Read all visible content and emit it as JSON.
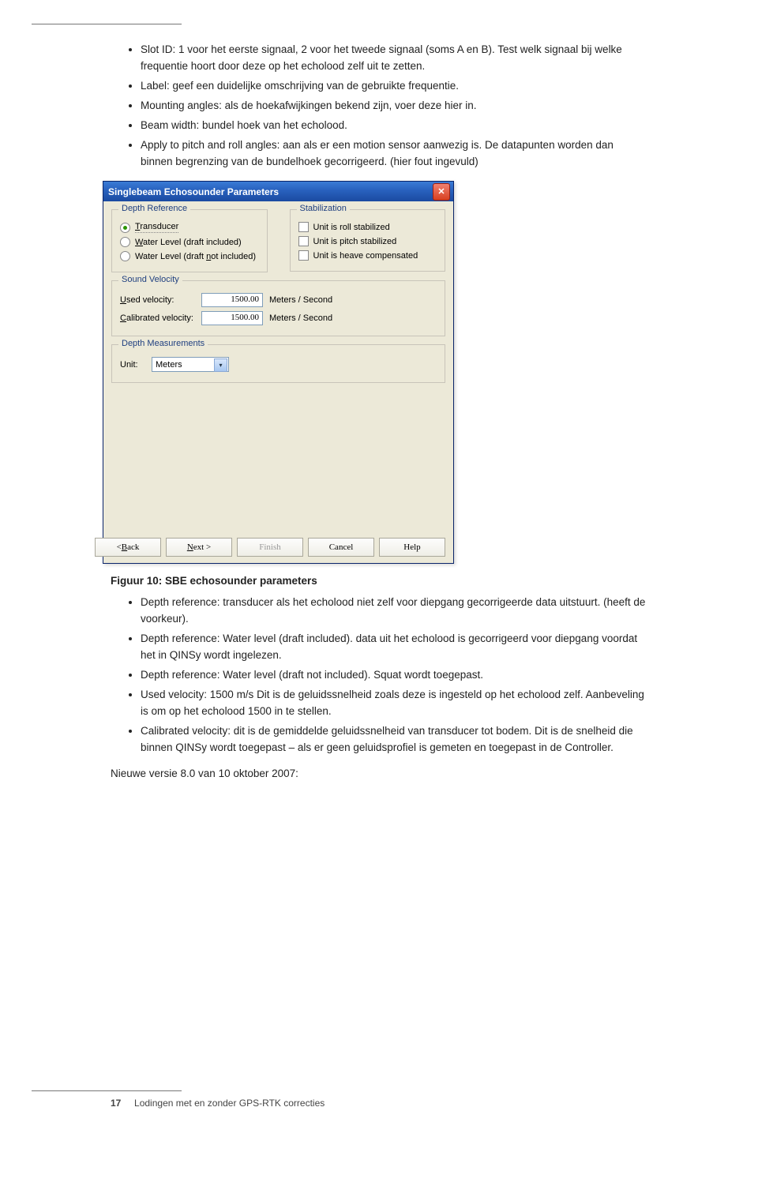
{
  "top_bullets": [
    "Slot ID: 1 voor het eerste signaal, 2 voor het tweede signaal (soms A en B). Test welk signaal bij welke frequentie hoort door deze op het echolood zelf uit te zetten.",
    "Label: geef een duidelijke omschrijving van de gebruikte frequentie.",
    "Mounting angles: als de hoekafwijkingen bekend zijn, voer deze hier in.",
    "Beam width: bundel hoek van het echolood.",
    "Apply to pitch and roll angles: aan als er een motion sensor aanwezig is. De datapunten worden dan binnen begrenzing van de bundelhoek gecorrigeerd. (hier fout ingevuld)"
  ],
  "dialog": {
    "title": "Singlebeam Echosounder Parameters",
    "groups": {
      "depth_ref": {
        "legend": "Depth Reference",
        "options": {
          "transducer": "Transducer",
          "draft_included": "Water Level (draft included)",
          "draft_not_included": "Water Level (draft not included)"
        }
      },
      "stabilization": {
        "legend": "Stabilization",
        "options": {
          "roll": "Unit is roll stabilized",
          "pitch": "Unit is pitch stabilized",
          "heave": "Unit is heave compensated"
        }
      },
      "sound_velocity": {
        "legend": "Sound Velocity",
        "used_label": "Used velocity:",
        "cal_label": "Calibrated velocity:",
        "used_value": "1500.00",
        "cal_value": "1500.00",
        "unit": "Meters / Second"
      },
      "depth_meas": {
        "legend": "Depth Measurements",
        "unit_label": "Unit:",
        "unit_value": "Meters"
      }
    },
    "buttons": {
      "back": "< Back",
      "next": "Next >",
      "finish": "Finish",
      "cancel": "Cancel",
      "help": "Help"
    }
  },
  "figure_caption": "Figuur 10: SBE echosounder parameters",
  "bottom_bullets": [
    "Depth reference: transducer als het echolood niet zelf voor diepgang gecorrigeerde data uitstuurt. (heeft de voorkeur).",
    "Depth reference: Water level (draft included). data uit het echolood is gecorrigeerd voor diepgang voordat het in QINSy wordt ingelezen.",
    "Depth reference: Water level (draft not included). Squat wordt toegepast.",
    "Used velocity: 1500 m/s Dit is de geluidssnelheid zoals deze is ingesteld op het echolood zelf. Aanbeveling is om op het echolood 1500 in te stellen.",
    "Calibrated velocity: dit is de gemiddelde geluidssnelheid van transducer tot bodem. Dit is de snelheid die binnen QINSy wordt toegepast – als er geen geluidsprofiel is gemeten en toegepast in de Controller."
  ],
  "subline": "Nieuwe versie 8.0 van 10 oktober 2007:",
  "footer": {
    "page": "17",
    "text": "Lodingen met en zonder GPS-RTK correcties"
  }
}
